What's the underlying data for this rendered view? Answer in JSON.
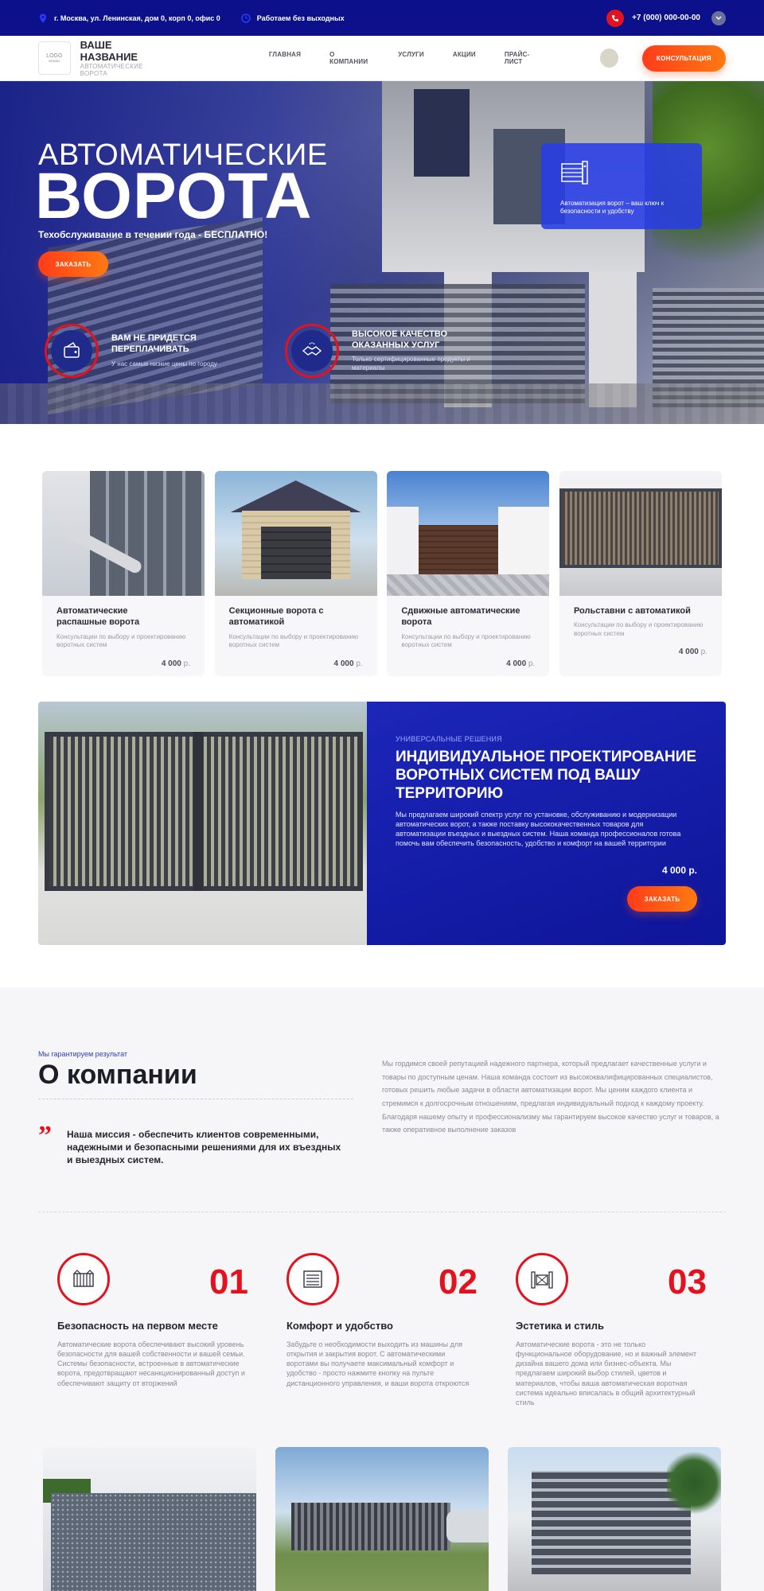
{
  "topbar": {
    "address": "г. Москва, ул. Ленинская, дом 0, корп 0, офис 0",
    "hours": "Работаем без выходных",
    "phone": "+7 (000) 000-00-00"
  },
  "header": {
    "logo_text": "LOGO",
    "logo_sub": "BRAND",
    "brand_name": "ВАШЕ НАЗВАНИЕ",
    "brand_sub": "АВТОМАТИЧЕСКИЕ ВОРОТА",
    "nav": [
      "ГЛАВНАЯ",
      "О КОМПАНИИ",
      "УСЛУГИ",
      "АКЦИИ",
      "ПРАЙС-ЛИСТ"
    ],
    "cta": "КОНСУЛЬТАЦИЯ"
  },
  "hero": {
    "title_small": "АВТОМАТИЧЕСКИЕ",
    "title_big": "ВОРОТА",
    "subtitle": "Техобслуживание в течении года - БЕСПЛАТНО!",
    "button": "ЗАКАЗАТЬ",
    "card_text": "Автоматизация ворот – ваш ключ к безопасности и удобству",
    "features": [
      {
        "title": "ВАМ НЕ ПРИДЕТСЯ ПЕРЕПЛАЧИВАТЬ",
        "desc": "У нас самые низкие цены по городу"
      },
      {
        "title": "ВЫСОКОЕ КАЧЕСТВО ОКАЗАННЫХ УСЛУГ",
        "desc": "Только сертифицированные продукты и материалы"
      }
    ]
  },
  "products": [
    {
      "title": "Автоматические распашные ворота",
      "desc": "Консультации по выбору и проектированию воротных систем",
      "price": "4 000",
      "currency": "р."
    },
    {
      "title": "Секционные ворота с автоматикой",
      "desc": "Консультации по выбору и проектированию воротных систем",
      "price": "4 000",
      "currency": "р."
    },
    {
      "title": "Сдвижные автоматические ворота",
      "desc": "Консультации по выбору и проектированию воротных систем",
      "price": "4 000",
      "currency": "р."
    },
    {
      "title": "Рольставни с автоматикой",
      "desc": "Консультации по выбору и проектированию воротных систем",
      "price": "4 000",
      "currency": "р."
    }
  ],
  "banner": {
    "eyebrow": "УНИВЕРСАЛЬНЫЕ РЕШЕНИЯ",
    "title": "ИНДИВИДУАЛЬНОЕ ПРОЕКТИРОВАНИЕ ВОРОТНЫХ СИСТЕМ ПОД ВАШУ ТЕРРИТОРИЮ",
    "desc": "Мы предлагаем широкий спектр услуг по установке, обслуживанию и модернизации автоматических ворот, а также поставку высококачественных товаров для автоматизации въездных и выездных систем. Наша команда профессионалов готова помочь вам обеспечить безопасность, удобство и комфорт на вашей территории",
    "price": "4 000 р.",
    "button": "ЗАКАЗАТЬ"
  },
  "about": {
    "eyebrow": "Мы гарантируем результат",
    "title": "О компании",
    "quote_mark": "”",
    "mission": "Наша миссия - обеспечить клиентов современными, надежными и безопасными решениями для их въездных и выездных систем.",
    "paragraph": "Мы гордимся своей репутацией надежного партнера, который предлагает качественные услуги и товары по доступным ценам. Наша команда состоит из высококвалифицированных специалистов, готовых решить любые задачи в области автоматизации ворот. Мы ценим каждого клиента и стремимся к долгосрочным отношениям, предлагая индивидуальный подход к каждому проекту. Благодаря нашему опыту и профессионализму мы гарантируем высокое качество услуг и товаров, а также оперативное выполнение заказов",
    "advantages": [
      {
        "num": "01",
        "title": "Безопасность на первом месте",
        "desc": "Автоматические ворота обеспечивают высокий уровень безопасности для вашей собственности и вашей семьи. Системы безопасности, встроенные в автоматические ворота, предотвращают несанкционированный доступ и обеспечивают защиту от вторжений"
      },
      {
        "num": "02",
        "title": "Комфорт и удобство",
        "desc": "Забудьте о необходимости выходить из машины для открытия и закрытия ворот. С автоматическими воротами вы получаете максимальный комфорт и удобство - просто нажмите кнопку на пульте дистанционного управления, и ваши ворота откроются"
      },
      {
        "num": "03",
        "title": "Эстетика и стиль",
        "desc": "Автоматические ворота - это не только функциональное оборудование, но и важный элемент дизайна вашего дома или бизнес-объекта. Мы предлагаем широкий выбор стилей, цветов и материалов, чтобы ваша автоматическая воротная система идеально вписалась в общий архитектурный стиль"
      }
    ]
  },
  "colors": {
    "primary_blue": "#0d108b",
    "accent_red": "#e3121f",
    "orange": "#ff5a16"
  }
}
